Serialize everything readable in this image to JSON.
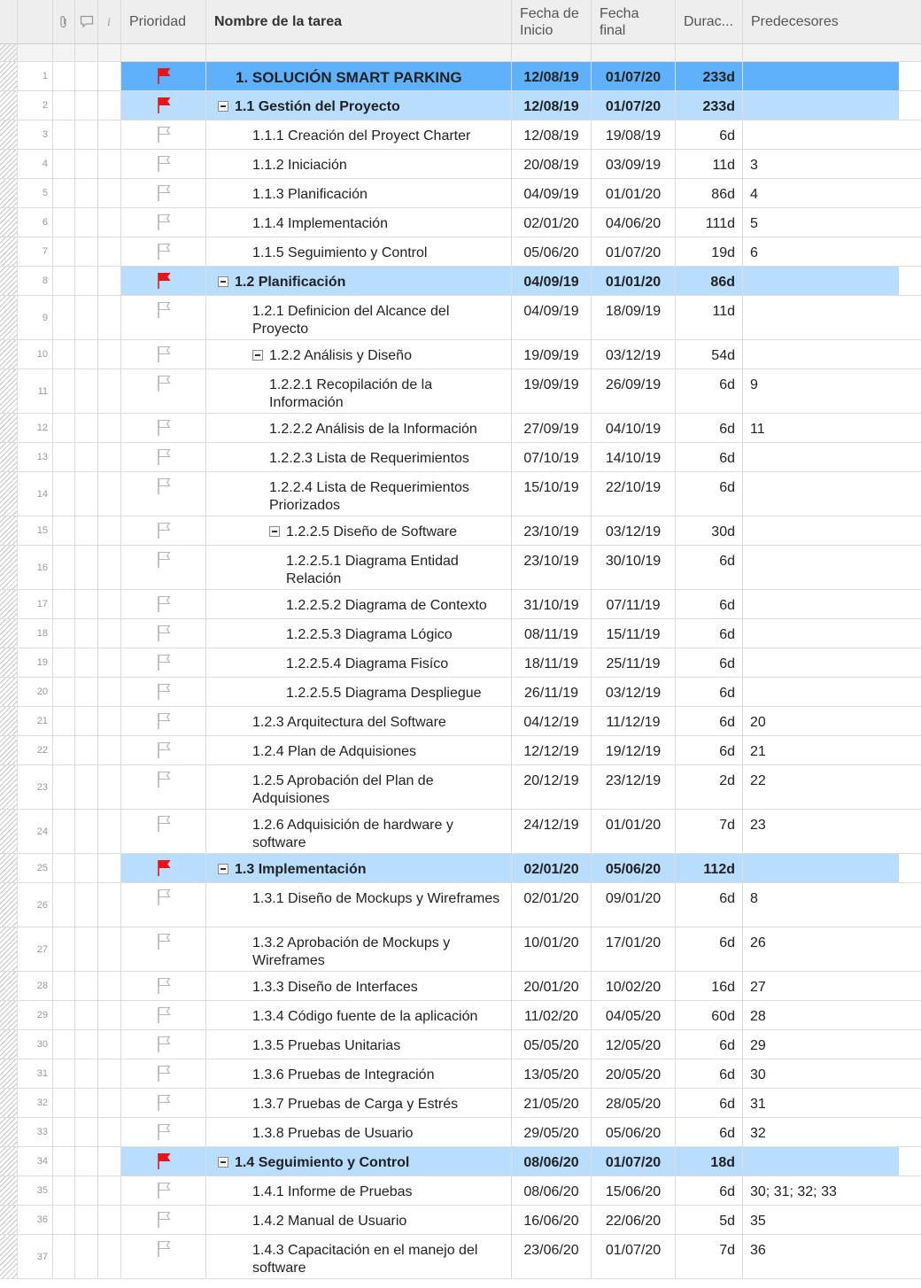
{
  "header": {
    "attachment_icon": "paperclip-icon",
    "comment_icon": "comment-icon",
    "info_icon": "info-icon",
    "priority": "Prioridad",
    "task_name": "Nombre de la tarea",
    "start_date": "Fecha de Inicio",
    "end_date": "Fecha final",
    "duration": "Durac...",
    "predecessors": "Predecesores"
  },
  "colors": {
    "summary_top": "#5fb1fb",
    "summary_phase": "#b8ddfd",
    "flag_high": "#e8141c",
    "flag_empty": "#b5b5b5"
  },
  "rows": [
    {
      "num": "1",
      "name": "1. SOLUCIÓN SMART PARKING",
      "start": "12/08/19",
      "end": "01/07/20",
      "dur": "233d",
      "pred": "",
      "level": 0,
      "summary": true,
      "flag": "high"
    },
    {
      "num": "2",
      "name": "1.1 Gestión del Proyecto",
      "start": "12/08/19",
      "end": "01/07/20",
      "dur": "233d",
      "pred": "",
      "level": 1,
      "summary": true,
      "flag": "high"
    },
    {
      "num": "3",
      "name": "1.1.1 Creación del Proyect Charter",
      "start": "12/08/19",
      "end": "19/08/19",
      "dur": "6d",
      "pred": "",
      "level": 2,
      "flag": "none"
    },
    {
      "num": "4",
      "name": "1.1.2 Iniciación",
      "start": "20/08/19",
      "end": "03/09/19",
      "dur": "11d",
      "pred": "3",
      "level": 2,
      "flag": "none"
    },
    {
      "num": "5",
      "name": "1.1.3 Planificación",
      "start": "04/09/19",
      "end": "01/01/20",
      "dur": "86d",
      "pred": "4",
      "level": 2,
      "flag": "none"
    },
    {
      "num": "6",
      "name": "1.1.4 Implementación",
      "start": "02/01/20",
      "end": "04/06/20",
      "dur": "111d",
      "pred": "5",
      "level": 2,
      "flag": "none"
    },
    {
      "num": "7",
      "name": "1.1.5 Seguimiento y Control",
      "start": "05/06/20",
      "end": "01/07/20",
      "dur": "19d",
      "pred": "6",
      "level": 2,
      "flag": "none"
    },
    {
      "num": "8",
      "name": "1.2 Planificación",
      "start": "04/09/19",
      "end": "01/01/20",
      "dur": "86d",
      "pred": "",
      "level": 1,
      "summary": true,
      "flag": "high"
    },
    {
      "num": "9",
      "name": "1.2.1 Definicion del Alcance del Proyecto",
      "start": "04/09/19",
      "end": "18/09/19",
      "dur": "11d",
      "pred": "",
      "level": 2,
      "flag": "none"
    },
    {
      "num": "10",
      "name": "1.2.2 Análisis y Diseño",
      "start": "19/09/19",
      "end": "03/12/19",
      "dur": "54d",
      "pred": "",
      "level": 2,
      "toggle": true,
      "flag": "none"
    },
    {
      "num": "11",
      "name": "1.2.2.1 Recopilación de la Información",
      "start": "19/09/19",
      "end": "26/09/19",
      "dur": "6d",
      "pred": "9",
      "level": 3,
      "flag": "none"
    },
    {
      "num": "12",
      "name": "1.2.2.2 Análisis de la Información",
      "start": "27/09/19",
      "end": "04/10/19",
      "dur": "6d",
      "pred": "11",
      "level": 3,
      "flag": "none"
    },
    {
      "num": "13",
      "name": "1.2.2.3 Lista de Requerimientos",
      "start": "07/10/19",
      "end": "14/10/19",
      "dur": "6d",
      "pred": "",
      "level": 3,
      "flag": "none"
    },
    {
      "num": "14",
      "name": "1.2.2.4 Lista de Requerimientos Priorizados",
      "start": "15/10/19",
      "end": "22/10/19",
      "dur": "6d",
      "pred": "",
      "level": 3,
      "flag": "none"
    },
    {
      "num": "15",
      "name": "1.2.2.5 Diseño de Software",
      "start": "23/10/19",
      "end": "03/12/19",
      "dur": "30d",
      "pred": "",
      "level": 3,
      "toggle": true,
      "flag": "none"
    },
    {
      "num": "16",
      "name": "1.2.2.5.1 Diagrama Entidad Relación",
      "start": "23/10/19",
      "end": "30/10/19",
      "dur": "6d",
      "pred": "",
      "level": 4,
      "flag": "none"
    },
    {
      "num": "17",
      "name": "1.2.2.5.2 Diagrama de Contexto",
      "start": "31/10/19",
      "end": "07/11/19",
      "dur": "6d",
      "pred": "",
      "level": 4,
      "flag": "none"
    },
    {
      "num": "18",
      "name": "1.2.2.5.3 Diagrama Lógico",
      "start": "08/11/19",
      "end": "15/11/19",
      "dur": "6d",
      "pred": "",
      "level": 4,
      "flag": "none"
    },
    {
      "num": "19",
      "name": "1.2.2.5.4 Diagrama Fisíco",
      "start": "18/11/19",
      "end": "25/11/19",
      "dur": "6d",
      "pred": "",
      "level": 4,
      "flag": "none"
    },
    {
      "num": "20",
      "name": "1.2.2.5.5 Diagrama Despliegue",
      "start": "26/11/19",
      "end": "03/12/19",
      "dur": "6d",
      "pred": "",
      "level": 4,
      "flag": "none"
    },
    {
      "num": "21",
      "name": "1.2.3 Arquitectura del Software",
      "start": "04/12/19",
      "end": "11/12/19",
      "dur": "6d",
      "pred": "20",
      "level": 2,
      "flag": "none"
    },
    {
      "num": "22",
      "name": "1.2.4 Plan de Adquisiones",
      "start": "12/12/19",
      "end": "19/12/19",
      "dur": "6d",
      "pred": "21",
      "level": 2,
      "flag": "none"
    },
    {
      "num": "23",
      "name": "1.2.5 Aprobación del Plan de Adquisiones",
      "start": "20/12/19",
      "end": "23/12/19",
      "dur": "2d",
      "pred": "22",
      "level": 2,
      "flag": "none"
    },
    {
      "num": "24",
      "name": "1.2.6 Adquisición de hardware y software",
      "start": "24/12/19",
      "end": "01/01/20",
      "dur": "7d",
      "pred": "23",
      "level": 2,
      "flag": "none"
    },
    {
      "num": "25",
      "name": "1.3 Implementación",
      "start": "02/01/20",
      "end": "05/06/20",
      "dur": "112d",
      "pred": "",
      "level": 1,
      "summary": true,
      "flag": "high"
    },
    {
      "num": "26",
      "name": "1.3.1 Diseño de Mockups y Wireframes",
      "start": "02/01/20",
      "end": "09/01/20",
      "dur": "6d",
      "pred": "8",
      "level": 2,
      "flag": "none"
    },
    {
      "num": "27",
      "name": "1.3.2 Aprobación de Mockups y Wireframes",
      "start": "10/01/20",
      "end": "17/01/20",
      "dur": "6d",
      "pred": "26",
      "level": 2,
      "flag": "none"
    },
    {
      "num": "28",
      "name": "1.3.3 Diseño de Interfaces",
      "start": "20/01/20",
      "end": "10/02/20",
      "dur": "16d",
      "pred": "27",
      "level": 2,
      "flag": "none"
    },
    {
      "num": "29",
      "name": "1.3.4 Código fuente de la aplicación",
      "start": "11/02/20",
      "end": "04/05/20",
      "dur": "60d",
      "pred": "28",
      "level": 2,
      "flag": "none"
    },
    {
      "num": "30",
      "name": "1.3.5 Pruebas Unitarias",
      "start": "05/05/20",
      "end": "12/05/20",
      "dur": "6d",
      "pred": "29",
      "level": 2,
      "flag": "none"
    },
    {
      "num": "31",
      "name": "1.3.6 Pruebas de Integración",
      "start": "13/05/20",
      "end": "20/05/20",
      "dur": "6d",
      "pred": "30",
      "level": 2,
      "flag": "none"
    },
    {
      "num": "32",
      "name": "1.3.7 Pruebas de Carga y Estrés",
      "start": "21/05/20",
      "end": "28/05/20",
      "dur": "6d",
      "pred": "31",
      "level": 2,
      "flag": "none"
    },
    {
      "num": "33",
      "name": "1.3.8 Pruebas de Usuario",
      "start": "29/05/20",
      "end": "05/06/20",
      "dur": "6d",
      "pred": "32",
      "level": 2,
      "flag": "none"
    },
    {
      "num": "34",
      "name": "1.4 Seguimiento y Control",
      "start": "08/06/20",
      "end": "01/07/20",
      "dur": "18d",
      "pred": "",
      "level": 1,
      "summary": true,
      "flag": "high"
    },
    {
      "num": "35",
      "name": "1.4.1 Informe de Pruebas",
      "start": "08/06/20",
      "end": "15/06/20",
      "dur": "6d",
      "pred": "30; 31; 32; 33",
      "level": 2,
      "flag": "none"
    },
    {
      "num": "36",
      "name": "1.4.2 Manual de Usuario",
      "start": "16/06/20",
      "end": "22/06/20",
      "dur": "5d",
      "pred": "35",
      "level": 2,
      "flag": "none"
    },
    {
      "num": "37",
      "name": "1.4.3 Capacitación en el manejo del software",
      "start": "23/06/20",
      "end": "01/07/20",
      "dur": "7d",
      "pred": "36",
      "level": 2,
      "flag": "none"
    }
  ]
}
